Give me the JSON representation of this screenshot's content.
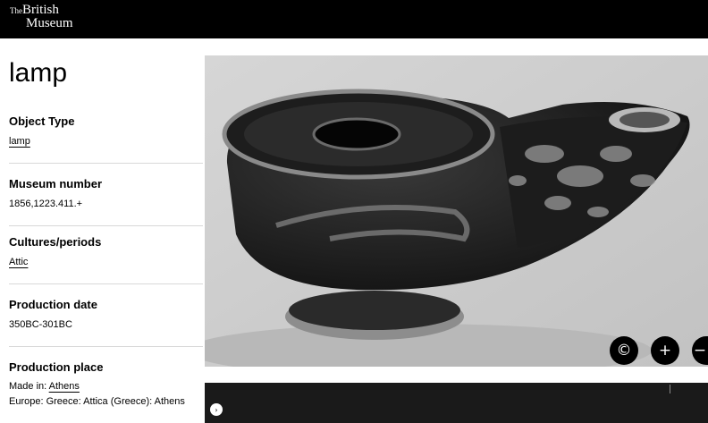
{
  "header": {
    "logo_the": "The",
    "logo_line1": "British",
    "logo_line2": "Museum"
  },
  "object": {
    "title": "lamp",
    "fields": [
      {
        "label": "Object Type",
        "value": "lamp"
      },
      {
        "label": "Museum number",
        "value": "1856,1223.411.+"
      },
      {
        "label": "Cultures/periods",
        "value": "Attic"
      },
      {
        "label": "Production date",
        "value": "350BC-301BC"
      },
      {
        "label": "Production place",
        "value_prefix": "Made in:",
        "value_link": "Athens",
        "value_line2": "Europe: Greece: Attica (Greece): Athens"
      }
    ]
  },
  "image_controls": {
    "copyright_icon": "©",
    "zoom_in_icon": "+",
    "zoom_out_icon": "−"
  },
  "media": {
    "play_icon": "›"
  },
  "colors": {
    "header_bg": "#000000",
    "media_bar_bg": "#1a1a1a"
  }
}
